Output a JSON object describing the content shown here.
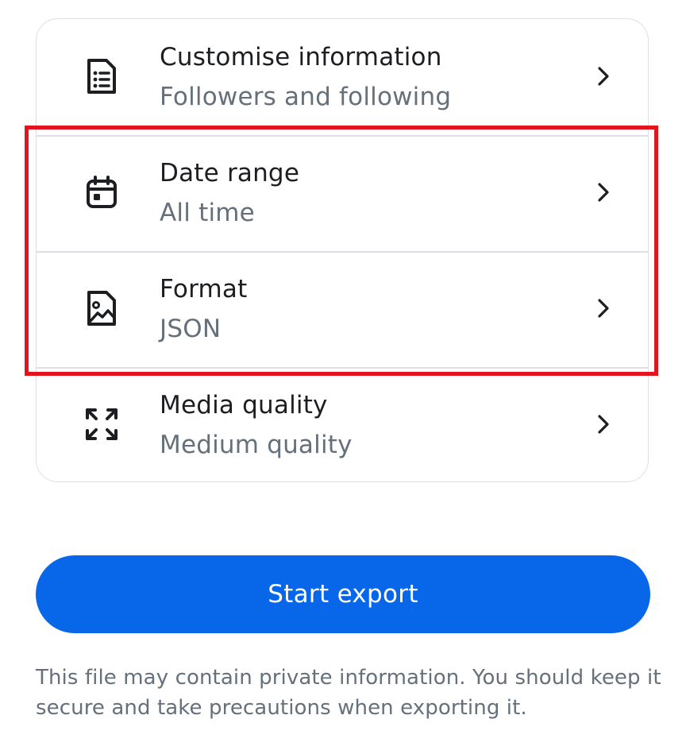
{
  "settings": {
    "rows": [
      {
        "title": "Customise information",
        "value": "Followers and following",
        "icon": "document-list-icon"
      },
      {
        "title": "Date range",
        "value": "All time",
        "icon": "calendar-icon"
      },
      {
        "title": "Format",
        "value": "JSON",
        "icon": "file-image-icon"
      },
      {
        "title": "Media quality",
        "value": "Medium quality",
        "icon": "expand-arrows-icon"
      }
    ]
  },
  "export_button": {
    "label": "Start export"
  },
  "disclaimer": "This file may contain private information. You should keep it secure and take precautions when exporting it.",
  "colors": {
    "accent": "#0866e8",
    "highlight": "#e3141e",
    "text_primary": "#1c1e21",
    "text_secondary": "#65707b"
  }
}
